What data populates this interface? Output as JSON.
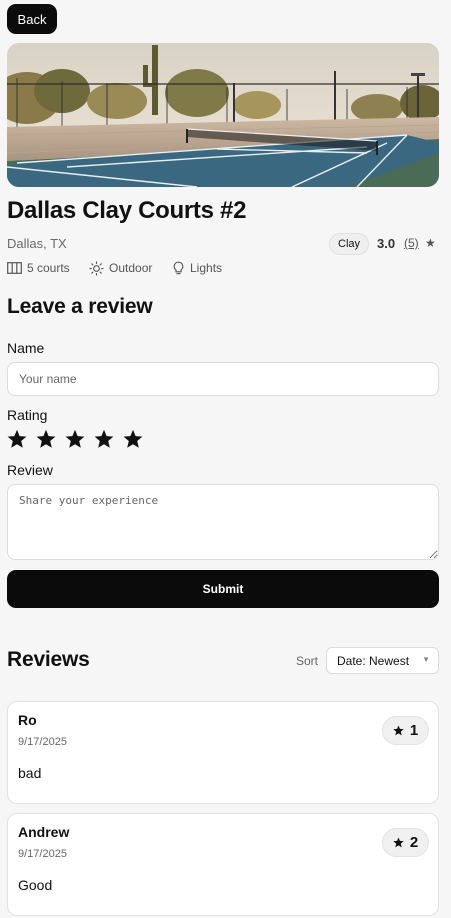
{
  "nav": {
    "back_label": "Back"
  },
  "court": {
    "name": "Dallas Clay Courts #2",
    "location": "Dallas, TX",
    "surface": "Clay",
    "rating_avg": "3.0",
    "rating_count": "(5)",
    "features": [
      {
        "icon": "court-count-icon",
        "label": "5 courts"
      },
      {
        "icon": "sun-icon",
        "label": "Outdoor"
      },
      {
        "icon": "lightbulb-icon",
        "label": "Lights"
      }
    ]
  },
  "review_form": {
    "title": "Leave a review",
    "name_label": "Name",
    "name_placeholder": "Your name",
    "name_value": "",
    "rating_label": "Rating",
    "rating_stars": 5,
    "review_label": "Review",
    "review_placeholder": "Share your experience",
    "submit_label": "Submit"
  },
  "reviews": {
    "title": "Reviews",
    "sort_label": "Sort",
    "sort_value": "Date: Newest",
    "items": [
      {
        "name": "Ro",
        "date": "9/17/2025",
        "text": "bad",
        "rating": "1"
      },
      {
        "name": "Andrew",
        "date": "9/17/2025",
        "text": "Good",
        "rating": "2"
      }
    ]
  },
  "colors": {
    "primary": "#0b0b0b",
    "background": "#f6f6f6",
    "court_blue": "#3a6880"
  }
}
